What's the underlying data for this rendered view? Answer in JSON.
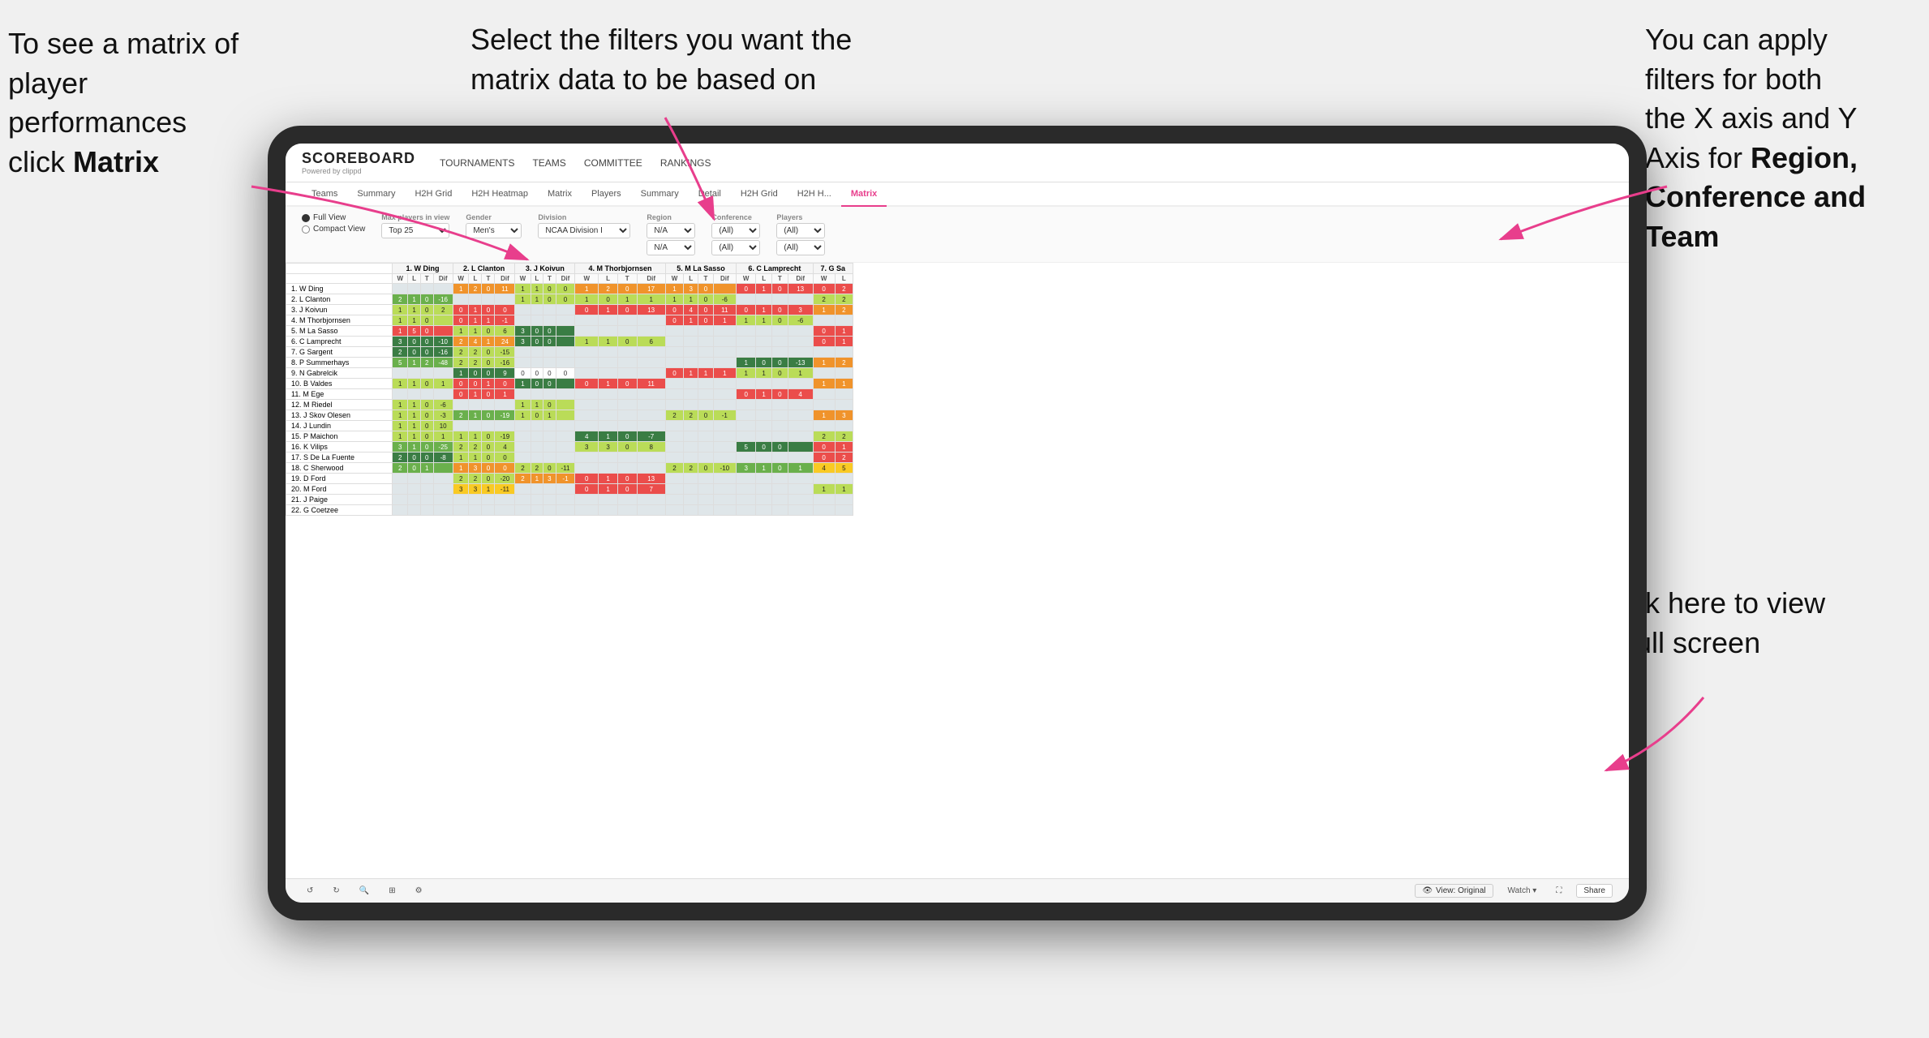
{
  "annotations": {
    "top_left": {
      "line1": "To see a matrix of",
      "line2": "player performances",
      "line3_prefix": "click ",
      "line3_bold": "Matrix"
    },
    "top_center": {
      "text": "Select the filters you want the matrix data to be based on"
    },
    "top_right": {
      "line1": "You  can apply",
      "line2": "filters for both",
      "line3": "the X axis and Y",
      "line4_prefix": "Axis for ",
      "line4_bold": "Region,",
      "line5_bold": "Conference and",
      "line6_bold": "Team"
    },
    "bottom_right": {
      "line1": "Click here to view",
      "line2": "in full screen"
    }
  },
  "header": {
    "logo_title": "SCOREBOARD",
    "logo_sub": "Powered by clippd",
    "nav": [
      "TOURNAMENTS",
      "TEAMS",
      "COMMITTEE",
      "RANKINGS"
    ]
  },
  "sub_nav": {
    "tabs": [
      "Teams",
      "Summary",
      "H2H Grid",
      "H2H Heatmap",
      "Matrix",
      "Players",
      "Summary",
      "Detail",
      "H2H Grid",
      "H2H H...",
      "Matrix"
    ],
    "active": "Matrix"
  },
  "filters": {
    "view_options": [
      "Full View",
      "Compact View"
    ],
    "active_view": "Full View",
    "max_players_label": "Max players in view",
    "max_players_value": "Top 25",
    "gender_label": "Gender",
    "gender_value": "Men's",
    "division_label": "Division",
    "division_value": "NCAA Division I",
    "region_label": "Region",
    "region_value": "N/A",
    "region_value2": "N/A",
    "conference_label": "Conference",
    "conference_value": "(All)",
    "conference_value2": "(All)",
    "players_label": "Players",
    "players_value": "(All)",
    "players_value2": "(All)"
  },
  "matrix": {
    "col_headers": [
      "1. W Ding",
      "2. L Clanton",
      "3. J Koivun",
      "4. M Thorbjornsen",
      "5. M La Sasso",
      "6. C Lamprecht",
      "7. G Sa"
    ],
    "sub_cols": [
      "W",
      "L",
      "T",
      "Dif"
    ],
    "rows": [
      {
        "name": "1. W Ding",
        "cells": [
          [
            "",
            "",
            "",
            ""
          ],
          [
            "1",
            "2",
            "0",
            "11"
          ],
          [
            "1",
            "1",
            "0",
            "0"
          ],
          [
            "1",
            "2",
            "0",
            "17"
          ],
          [
            "1",
            "3",
            "0",
            ""
          ],
          [
            "0",
            "1",
            "0",
            "13"
          ],
          [
            "0",
            "2",
            ""
          ]
        ]
      },
      {
        "name": "2. L Clanton",
        "cells": [
          [
            "2",
            "1",
            "0",
            "-16"
          ],
          [
            "",
            "",
            "",
            ""
          ],
          [
            "1",
            "1",
            "0",
            "0"
          ],
          [
            "1",
            "0",
            "1",
            "1"
          ],
          [
            "1",
            "1",
            "0",
            "-6"
          ],
          [
            "",
            "",
            "",
            ""
          ],
          [
            "2",
            "2",
            ""
          ]
        ]
      },
      {
        "name": "3. J Koivun",
        "cells": [
          [
            "1",
            "1",
            "0",
            "2"
          ],
          [
            "0",
            "1",
            "0",
            "0"
          ],
          [
            "",
            "",
            "",
            ""
          ],
          [
            "0",
            "1",
            "0",
            "13"
          ],
          [
            "0",
            "4",
            "0",
            "11"
          ],
          [
            "0",
            "1",
            "0",
            "3"
          ],
          [
            "1",
            "2",
            ""
          ]
        ]
      },
      {
        "name": "4. M Thorbjornsen",
        "cells": [
          [
            "1",
            "1",
            "0",
            ""
          ],
          [
            "0",
            "1",
            "1",
            "-1"
          ],
          [
            "",
            "",
            "",
            ""
          ],
          [
            "",
            "",
            "",
            ""
          ],
          [
            "0",
            "1",
            "0",
            "1"
          ],
          [
            "1",
            "1",
            "0",
            "-6"
          ],
          [
            "",
            ""
          ]
        ]
      },
      {
        "name": "5. M La Sasso",
        "cells": [
          [
            "1",
            "5",
            "0",
            ""
          ],
          [
            "1",
            "1",
            "0",
            "6"
          ],
          [
            "3",
            "0",
            "0",
            ""
          ],
          [
            "",
            "",
            "",
            ""
          ],
          [
            "",
            "",
            "",
            ""
          ],
          [
            "",
            "",
            "",
            ""
          ],
          [
            "0",
            "1",
            ""
          ]
        ]
      },
      {
        "name": "6. C Lamprecht",
        "cells": [
          [
            "3",
            "0",
            "0",
            "-10"
          ],
          [
            "2",
            "4",
            "1",
            "24"
          ],
          [
            "3",
            "0",
            "0",
            ""
          ],
          [
            "1",
            "1",
            "0",
            "6"
          ],
          [
            "",
            "",
            "",
            ""
          ],
          [
            "",
            "",
            "",
            ""
          ],
          [
            "0",
            "1",
            ""
          ]
        ]
      },
      {
        "name": "7. G Sargent",
        "cells": [
          [
            "2",
            "0",
            "0",
            "-16"
          ],
          [
            "2",
            "2",
            "0",
            "-15"
          ],
          [
            "",
            "",
            "",
            ""
          ],
          [
            "",
            "",
            "",
            ""
          ],
          [
            "",
            "",
            "",
            ""
          ],
          [
            "",
            "",
            "",
            ""
          ],
          [
            "",
            ""
          ]
        ]
      },
      {
        "name": "8. P Summerhays",
        "cells": [
          [
            "5",
            "1",
            "2",
            "-48"
          ],
          [
            "2",
            "2",
            "0",
            "-16"
          ],
          [
            "",
            "",
            "",
            ""
          ],
          [
            "",
            "",
            "",
            ""
          ],
          [
            "",
            "",
            "",
            ""
          ],
          [
            "1",
            "0",
            "0",
            "-13"
          ],
          [
            "1",
            "2",
            ""
          ]
        ]
      },
      {
        "name": "9. N Gabrelcik",
        "cells": [
          [
            "",
            "",
            "",
            ""
          ],
          [
            "1",
            "0",
            "0",
            "9"
          ],
          [
            "0",
            "0",
            "0",
            "0"
          ],
          [
            "",
            "",
            "",
            ""
          ],
          [
            "0",
            "1",
            "1",
            "1"
          ],
          [
            "1",
            "1",
            "0",
            "1"
          ],
          [
            "",
            ""
          ]
        ]
      },
      {
        "name": "10. B Valdes",
        "cells": [
          [
            "1",
            "1",
            "0",
            "1"
          ],
          [
            "0",
            "0",
            "1",
            "0"
          ],
          [
            "1",
            "0",
            "0",
            ""
          ],
          [
            "0",
            "1",
            "0",
            "11"
          ],
          [
            "",
            "",
            "",
            ""
          ],
          [
            "",
            "",
            "",
            ""
          ],
          [
            "1",
            "1",
            "1"
          ]
        ]
      },
      {
        "name": "11. M Ege",
        "cells": [
          [
            "",
            "",
            "",
            ""
          ],
          [
            "0",
            "1",
            "0",
            "1"
          ],
          [
            "",
            "",
            "",
            ""
          ],
          [
            "",
            "",
            "",
            ""
          ],
          [
            "",
            "",
            "",
            ""
          ],
          [
            "0",
            "1",
            "0",
            "4"
          ],
          [
            "",
            ""
          ]
        ]
      },
      {
        "name": "12. M Riedel",
        "cells": [
          [
            "1",
            "1",
            "0",
            "-6"
          ],
          [
            "",
            "",
            "",
            ""
          ],
          [
            "1",
            "1",
            "0",
            ""
          ],
          [
            "",
            "",
            "",
            ""
          ],
          [
            "",
            "",
            "",
            ""
          ],
          [
            "",
            "",
            "",
            ""
          ],
          [
            "",
            ""
          ]
        ]
      },
      {
        "name": "13. J Skov Olesen",
        "cells": [
          [
            "1",
            "1",
            "0",
            "-3"
          ],
          [
            "2",
            "1",
            "0",
            "-19"
          ],
          [
            "1",
            "0",
            "1",
            ""
          ],
          [
            "",
            "",
            "",
            ""
          ],
          [
            "2",
            "2",
            "0",
            "-1"
          ],
          [
            "",
            "",
            "",
            ""
          ],
          [
            "1",
            "3",
            ""
          ]
        ]
      },
      {
        "name": "14. J Lundin",
        "cells": [
          [
            "1",
            "1",
            "0",
            "10"
          ],
          [
            "",
            "",
            "",
            ""
          ],
          [
            "",
            "",
            "",
            ""
          ],
          [
            "",
            "",
            "",
            ""
          ],
          [
            "",
            "",
            "",
            ""
          ],
          [
            "",
            "",
            "",
            ""
          ],
          [
            "",
            ""
          ]
        ]
      },
      {
        "name": "15. P Maichon",
        "cells": [
          [
            "1",
            "1",
            "0",
            "1"
          ],
          [
            "1",
            "1",
            "0",
            "-19"
          ],
          [
            "",
            "",
            "",
            ""
          ],
          [
            "4",
            "1",
            "0",
            "-7"
          ],
          [
            "",
            "",
            "",
            ""
          ],
          [
            "",
            "",
            "",
            ""
          ],
          [
            "2",
            "2",
            ""
          ]
        ]
      },
      {
        "name": "16. K Vilips",
        "cells": [
          [
            "3",
            "1",
            "0",
            "-25"
          ],
          [
            "2",
            "2",
            "0",
            "4"
          ],
          [
            "",
            "",
            "",
            ""
          ],
          [
            "3",
            "3",
            "0",
            "8"
          ],
          [
            "",
            "",
            "",
            ""
          ],
          [
            "5",
            "0",
            "0",
            ""
          ],
          [
            "0",
            "1",
            ""
          ]
        ]
      },
      {
        "name": "17. S De La Fuente",
        "cells": [
          [
            "2",
            "0",
            "0",
            "-8"
          ],
          [
            "1",
            "1",
            "0",
            "0"
          ],
          [
            "",
            "",
            "",
            ""
          ],
          [
            "",
            "",
            "",
            ""
          ],
          [
            "",
            "",
            "",
            ""
          ],
          [
            "",
            "",
            "",
            ""
          ],
          [
            "0",
            "2",
            ""
          ]
        ]
      },
      {
        "name": "18. C Sherwood",
        "cells": [
          [
            "2",
            "0",
            "1",
            ""
          ],
          [
            "1",
            "3",
            "0",
            "0"
          ],
          [
            "2",
            "2",
            "0",
            "-11"
          ],
          [
            "",
            "",
            "",
            ""
          ],
          [
            "2",
            "2",
            "0",
            "-10"
          ],
          [
            "3",
            "1",
            "0",
            "1"
          ],
          [
            "4",
            "5",
            ""
          ]
        ]
      },
      {
        "name": "19. D Ford",
        "cells": [
          [
            "",
            "",
            "",
            ""
          ],
          [
            "2",
            "2",
            "0",
            "-20"
          ],
          [
            "2",
            "1",
            "3",
            "-1"
          ],
          [
            "0",
            "1",
            "0",
            "13"
          ],
          [
            "",
            "",
            "",
            ""
          ],
          [
            "",
            "",
            "",
            ""
          ],
          [
            "",
            ""
          ]
        ]
      },
      {
        "name": "20. M Ford",
        "cells": [
          [
            "",
            "",
            "",
            ""
          ],
          [
            "3",
            "3",
            "1",
            "-11"
          ],
          [
            "",
            "",
            "",
            ""
          ],
          [
            "0",
            "1",
            "0",
            "7"
          ],
          [
            "",
            "",
            "",
            ""
          ],
          [
            "",
            "",
            "",
            ""
          ],
          [
            "1",
            "1",
            ""
          ]
        ]
      },
      {
        "name": "21. J Paige",
        "cells": [
          [
            "",
            "",
            "",
            ""
          ],
          [
            "",
            "",
            "",
            ""
          ],
          [
            "",
            "",
            "",
            ""
          ],
          [
            "",
            "",
            "",
            ""
          ],
          [
            "",
            "",
            "",
            ""
          ],
          [
            "",
            "",
            "",
            ""
          ],
          [
            "",
            ""
          ]
        ]
      },
      {
        "name": "22. G Coetzee",
        "cells": [
          [
            "",
            "",
            "",
            ""
          ],
          [
            "",
            "",
            "",
            ""
          ],
          [
            "",
            "",
            "",
            ""
          ],
          [
            "",
            "",
            "",
            ""
          ],
          [
            "",
            "",
            "",
            ""
          ],
          [
            "",
            "",
            "",
            ""
          ],
          [
            "",
            "",
            ""
          ]
        ]
      }
    ]
  },
  "toolbar": {
    "undo_label": "↺",
    "redo_label": "↻",
    "view_original_label": "View: Original",
    "watch_label": "Watch ▾",
    "share_label": "Share"
  },
  "colors": {
    "accent": "#e83e8c",
    "bg": "#f0f0f0",
    "tablet_frame": "#2a2a2a"
  }
}
